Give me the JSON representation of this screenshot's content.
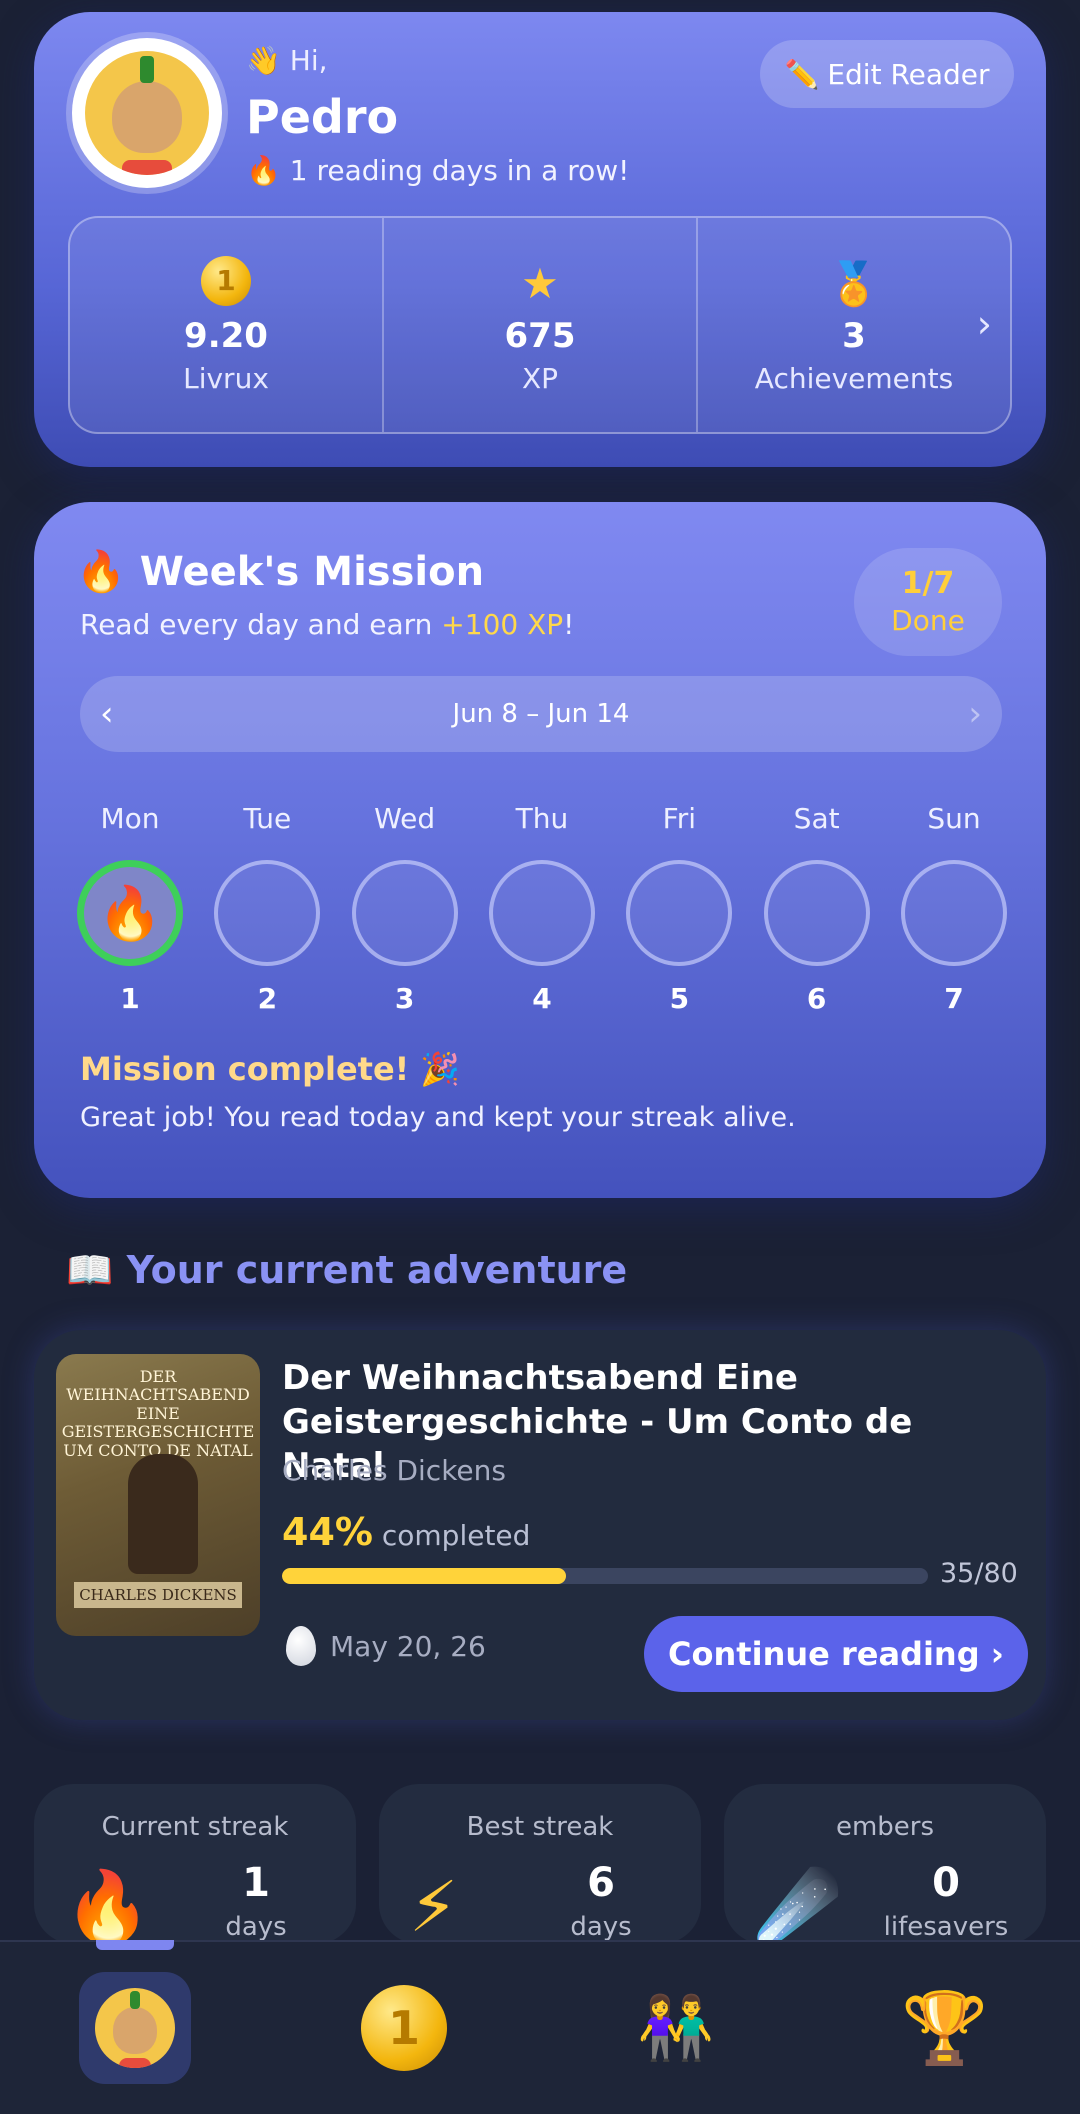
{
  "profile": {
    "greeting_icon": "waving-hand",
    "greeting": "Hi,",
    "name": "Pedro",
    "streak_text": "1 reading days in a row!",
    "edit_label": "Edit Reader",
    "stats": [
      {
        "icon": "coin-icon",
        "value": "9.20",
        "label": "Livrux"
      },
      {
        "icon": "star-icon",
        "value": "675",
        "label": "XP"
      },
      {
        "icon": "medal-icon",
        "value": "3",
        "label": "Achievements"
      }
    ]
  },
  "mission": {
    "title": "Week's Mission",
    "subtitle_before": "Read every day and earn ",
    "subtitle_xp": "+100 XP",
    "subtitle_after": "!",
    "progress": "1/7",
    "progress_label": "Done",
    "week_range": "Jun 8 – Jun 14",
    "days": [
      {
        "name": "Mon",
        "num": "1",
        "done": true
      },
      {
        "name": "Tue",
        "num": "2",
        "done": false
      },
      {
        "name": "Wed",
        "num": "3",
        "done": false
      },
      {
        "name": "Thu",
        "num": "4",
        "done": false
      },
      {
        "name": "Fri",
        "num": "5",
        "done": false
      },
      {
        "name": "Sat",
        "num": "6",
        "done": false
      },
      {
        "name": "Sun",
        "num": "7",
        "done": false
      }
    ],
    "complete_title": "Mission complete! 🎉",
    "complete_text": "Great job! You read today and kept your streak alive."
  },
  "adventure": {
    "heading": "Your current adventure",
    "cover_title": "DER WEIHNACHTSABEND EINE GEISTERGESCHICHTE UM CONTO DE NATAL",
    "cover_author": "CHARLES DICKENS",
    "title": "Der Weihnachtsabend Eine Geistergeschichte - Um Conto de Natal",
    "author": "Charles Dickens",
    "percent": "44%",
    "percent_label": "completed",
    "progress_fraction": 0.44,
    "pages": "35/80",
    "date": "May 20, 26",
    "continue_label": "Continue reading ›"
  },
  "streaks": [
    {
      "title": "Current streak",
      "icon": "fire-icon",
      "value": "1",
      "unit": "days"
    },
    {
      "title": "Best streak",
      "icon": "lightning-icon",
      "value": "6",
      "unit": "days"
    },
    {
      "title": "embers",
      "icon": "meteor-icon",
      "value": "0",
      "unit": "lifesavers"
    }
  ],
  "nav": [
    {
      "icon": "avatar-icon",
      "active": true
    },
    {
      "icon": "coin-icon",
      "active": false
    },
    {
      "icon": "friends-icon",
      "active": false
    },
    {
      "icon": "trophy-icon",
      "active": false
    }
  ],
  "colors": {
    "accent": "#5b63ea",
    "gold": "#ffd33a",
    "background": "#1b2135",
    "done_ring": "#3ecf5a"
  }
}
